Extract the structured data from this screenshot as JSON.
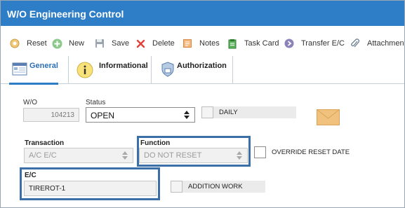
{
  "window": {
    "title": "W/O Engineering Control"
  },
  "toolbar": {
    "reset": "Reset",
    "new": "New",
    "save": "Save",
    "delete": "Delete",
    "notes": "Notes",
    "task_card": "Task Card",
    "transfer_ec": "Transfer E/C",
    "attachment": "Attachment"
  },
  "tabs": {
    "general": "General",
    "informational": "Informational",
    "authorization": "Authorization"
  },
  "form": {
    "wo_label": "W/O",
    "wo_value": "104213",
    "status_label": "Status",
    "status_value": "OPEN",
    "daily_label": "DAILY",
    "transaction_label": "Transaction",
    "transaction_value": "A/C E/C",
    "function_label": "Function",
    "function_value": "DO NOT RESET",
    "override_label": "OVERRIDE RESET DATE",
    "ec_label": "E/C",
    "ec_value": "TIREROT-1",
    "addition_label": "ADDITION WORK"
  },
  "colors": {
    "title_bar": "#2e7ec7",
    "highlight_border": "#3c6ea7",
    "active_tab_text": "#2e6fb7",
    "envelope": "#f1c27d"
  },
  "icons": {
    "reset": "reset-icon",
    "new": "plus-circle-icon",
    "save": "floppy-disk-icon",
    "delete": "red-x-icon",
    "notes": "notepad-icon",
    "task_card": "clipboard-icon",
    "transfer_ec": "arrow-right-circle-icon",
    "attachment": "paperclip-icon",
    "envelope": "envelope-icon"
  }
}
